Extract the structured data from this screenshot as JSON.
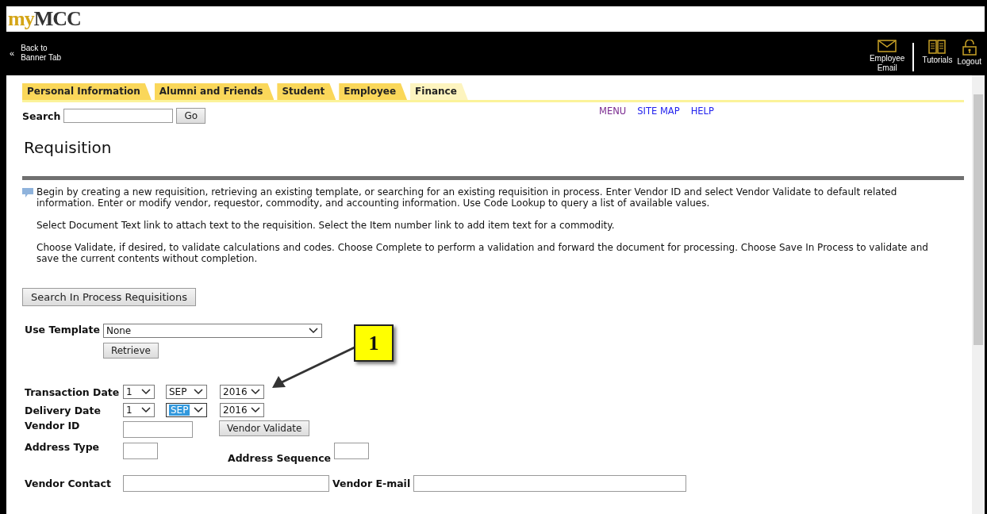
{
  "logo": {
    "prefix": "my",
    "name": "MCC"
  },
  "topbar": {
    "back_link": {
      "arrow": "«",
      "line1": "Back to",
      "line2": "Banner Tab"
    },
    "actions": [
      {
        "kind": "email",
        "label_1": "Employee",
        "label_2": "Email"
      },
      {
        "kind": "book",
        "label_1": "Tutorials"
      },
      {
        "kind": "lock",
        "label_1": "Logout"
      }
    ]
  },
  "tabs": [
    {
      "label": "Personal Information",
      "selected": false
    },
    {
      "label": "Alumni and Friends",
      "selected": false
    },
    {
      "label": "Student",
      "selected": false
    },
    {
      "label": "Employee",
      "selected": false
    },
    {
      "label": "Finance",
      "selected": true
    }
  ],
  "search": {
    "label": "Search",
    "button": "Go"
  },
  "nav_links": [
    {
      "label": "MENU",
      "visited": true
    },
    {
      "label": "SITE MAP",
      "visited": false
    },
    {
      "label": "HELP",
      "visited": false
    }
  ],
  "page_title": "Requisition",
  "info": [
    "Begin by creating a new requisition, retrieving an existing template, or searching for an existing requisition in process. Enter Vendor ID and select Vendor Validate to default related information. Enter or modify vendor, requestor, commodity, and accounting information. Use Code Lookup to query a list of available values.",
    "Select Document Text link to attach text to the requisition. Select the Item number link to add item text for a commodity.",
    "Choose Validate, if desired, to validate calculations and codes. Choose Complete to perform a validation and forward the document for processing. Choose Save In Process to validate and save the current contents without completion."
  ],
  "search_in_process_button": "Search In Process Requisitions",
  "template": {
    "label": "Use Template",
    "value": "None",
    "button": "Retrieve"
  },
  "dates": [
    {
      "label": "Transaction Date",
      "day": {
        "value": "1",
        "highlighted": false
      },
      "month": {
        "value": "SEP",
        "highlighted": false
      },
      "year": {
        "value": "2016",
        "highlighted": false
      }
    },
    {
      "label": "Delivery Date",
      "day": {
        "value": "1",
        "highlighted": false
      },
      "month": {
        "value": "SEP",
        "highlighted": true
      },
      "year": {
        "value": "2016",
        "highlighted": false
      }
    }
  ],
  "vendor_id": {
    "label": "Vendor ID",
    "button": "Vendor Validate"
  },
  "address_type": {
    "label": "Address Type"
  },
  "address_sequence": {
    "label": "Address Sequence"
  },
  "vendor_contact": {
    "label": "Vendor Contact"
  },
  "vendor_email": {
    "label": "Vendor E-mail"
  },
  "callout": {
    "number": "1"
  }
}
